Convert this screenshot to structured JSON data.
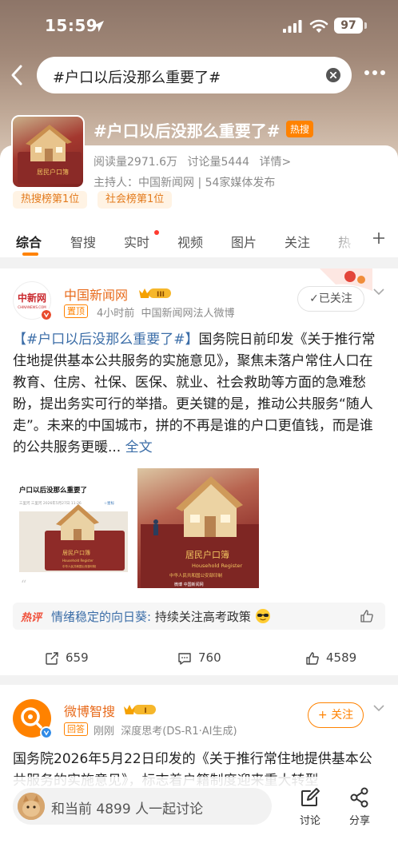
{
  "status_bar": {
    "time": "15:59",
    "battery": "97"
  },
  "search": {
    "query": "#户口以后没那么重要了#"
  },
  "topic": {
    "title": "#户口以后没那么重要了#",
    "hot_label": "热搜",
    "read_count": "阅读量2971.6万",
    "discuss_count": "讨论量5444",
    "detail_link": "详情>",
    "host": "主持人：中国新闻网 | 54家媒体发布",
    "rank_tags": [
      "热搜榜第1位",
      "社会榜第1位"
    ],
    "thumb_text": "居民户口簿"
  },
  "tabs": [
    "综合",
    "智搜",
    "实时",
    "视频",
    "图片",
    "关注",
    "热"
  ],
  "post1": {
    "avatar_text": "中新网",
    "avatar_subtext": "CHINANEWS.COM",
    "author": "中国新闻网",
    "level": "III",
    "pin_label": "置顶",
    "time": "4小时前",
    "source": "中国新闻网法人微博",
    "follow_status": "已关注",
    "hashtag": "【#户口以后没那么重要了#】",
    "body": "国务院日前印发《关于推行常住地提供基本公共服务的实施意见》，聚焦未落户常住人口在教育、住房、社保、医保、就业、社会救助等方面的急难愁盼，提出务实可行的举措。更关键的是，推动公共服务“随人走”。未来的中国城市，拼的不再是谁的户口更值钱，而是谁的公共服务更暖...",
    "full_text_link": "全文",
    "image1": {
      "headline": "户口以后没那么重要了",
      "byline": "三里河 三里河  2026年5月27日 11:26",
      "byline_tag": "☆星标",
      "book_title": "居民户口簿",
      "book_en": "Household Register",
      "book_sub": "中华人民共和国公安部印制"
    },
    "image2": {
      "book_title": "居民户口簿",
      "book_en": "Household Register",
      "book_sub": "中华人民共和国公安部印制",
      "watermark": "微博 中国新闻网"
    },
    "hot_comment_tag": "热评",
    "hot_comment_user": "情绪稳定的向日葵:",
    "hot_comment_text": "持续关注高考政策",
    "reposts": "659",
    "comments": "760",
    "likes": "4589"
  },
  "post2": {
    "author": "微博智搜",
    "level": "I",
    "answer_label": "回答",
    "time": "刚刚",
    "source": "深度思考(DS-R1·AI生成)",
    "follow_label": "+ 关注",
    "body": "国务院2026年5月22日印发的《关于推行常住地提供基本公共服务的实施意见》，标志着户籍制度迎来重大转型"
  },
  "bottom_bar": {
    "discuss_placeholder": "和当前 4899 人一起讨论",
    "comment_label": "讨论",
    "share_label": "分享"
  },
  "colors": {
    "accent": "#ff8200",
    "link": "#3c6ea8",
    "hot": "#f04e38"
  }
}
